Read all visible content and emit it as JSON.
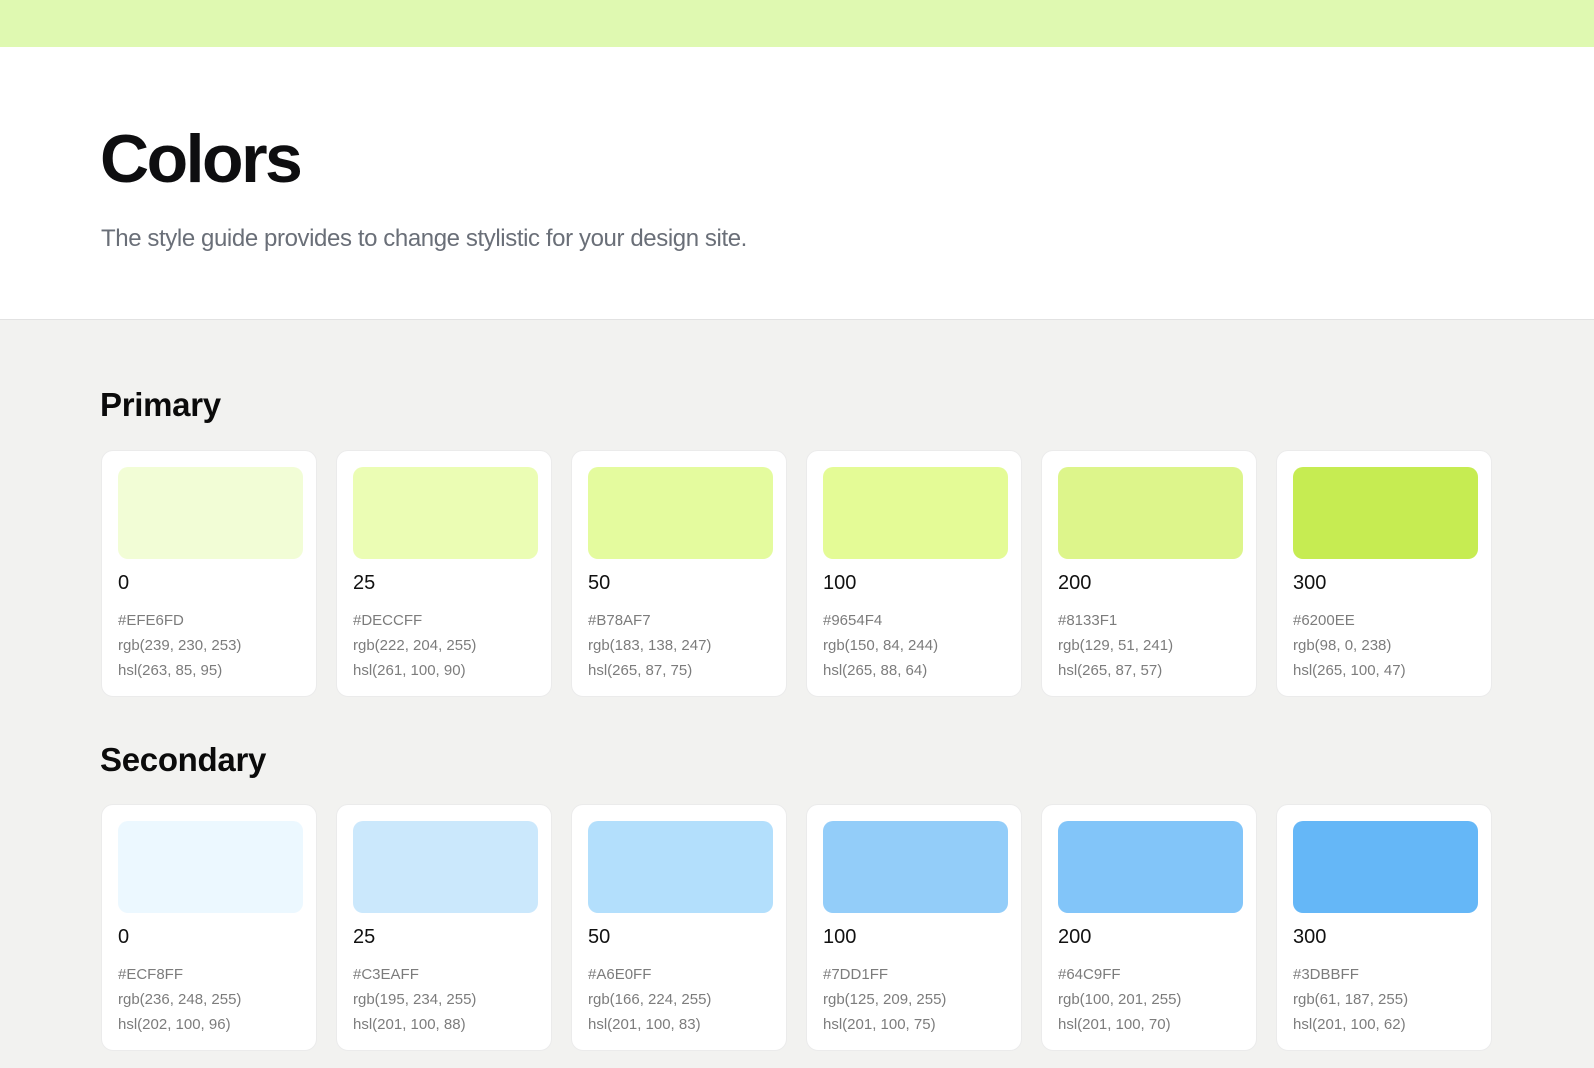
{
  "header": {
    "title": "Colors",
    "subtitle": "The style guide provides to change stylistic for your design site."
  },
  "top_bar_color": "#DFF9B1",
  "sections": [
    {
      "title": "Primary",
      "swatches": [
        {
          "level": "0",
          "hex": "#EFE6FD",
          "rgb": "rgb(239, 230, 253)",
          "hsl": "hsl(263, 85, 95)",
          "display_color": "#F2FDD6"
        },
        {
          "level": "25",
          "hex": "#DECCFF",
          "rgb": "rgb(222, 204, 255)",
          "hsl": "hsl(261, 100, 90)",
          "display_color": "#EBFDB4"
        },
        {
          "level": "50",
          "hex": "#B78AF7",
          "rgb": "rgb(183, 138, 247)",
          "hsl": "hsl(265, 87, 75)",
          "display_color": "#E4FB9E"
        },
        {
          "level": "100",
          "hex": "#9654F4",
          "rgb": "rgb(150, 84, 244)",
          "hsl": "hsl(265, 88, 64)",
          "display_color": "#E4FB96"
        },
        {
          "level": "200",
          "hex": "#8133F1",
          "rgb": "rgb(129, 51, 241)",
          "hsl": "hsl(265, 87, 57)",
          "display_color": "#DDF58B"
        },
        {
          "level": "300",
          "hex": "#6200EE",
          "rgb": "rgb(98, 0, 238)",
          "hsl": "hsl(265, 100, 47)",
          "display_color": "#C6EC52"
        }
      ]
    },
    {
      "title": "Secondary",
      "swatches": [
        {
          "level": "0",
          "hex": "#ECF8FF",
          "rgb": "rgb(236, 248, 255)",
          "hsl": "hsl(202, 100, 96)",
          "display_color": "#ECF8FF"
        },
        {
          "level": "25",
          "hex": "#C3EAFF",
          "rgb": "rgb(195, 234, 255)",
          "hsl": "hsl(201, 100, 88)",
          "display_color": "#CBE8FC"
        },
        {
          "level": "50",
          "hex": "#A6E0FF",
          "rgb": "rgb(166, 224, 255)",
          "hsl": "hsl(201, 100, 83)",
          "display_color": "#B3DFFC"
        },
        {
          "level": "100",
          "hex": "#7DD1FF",
          "rgb": "rgb(125, 209, 255)",
          "hsl": "hsl(201, 100, 75)",
          "display_color": "#93CDF9"
        },
        {
          "level": "200",
          "hex": "#64C9FF",
          "rgb": "rgb(100, 201, 255)",
          "hsl": "hsl(201, 100, 70)",
          "display_color": "#82C5F9"
        },
        {
          "level": "300",
          "hex": "#3DBBFF",
          "rgb": "rgb(61, 187, 255)",
          "hsl": "hsl(201, 100, 62)",
          "display_color": "#65B7F7"
        }
      ]
    }
  ]
}
